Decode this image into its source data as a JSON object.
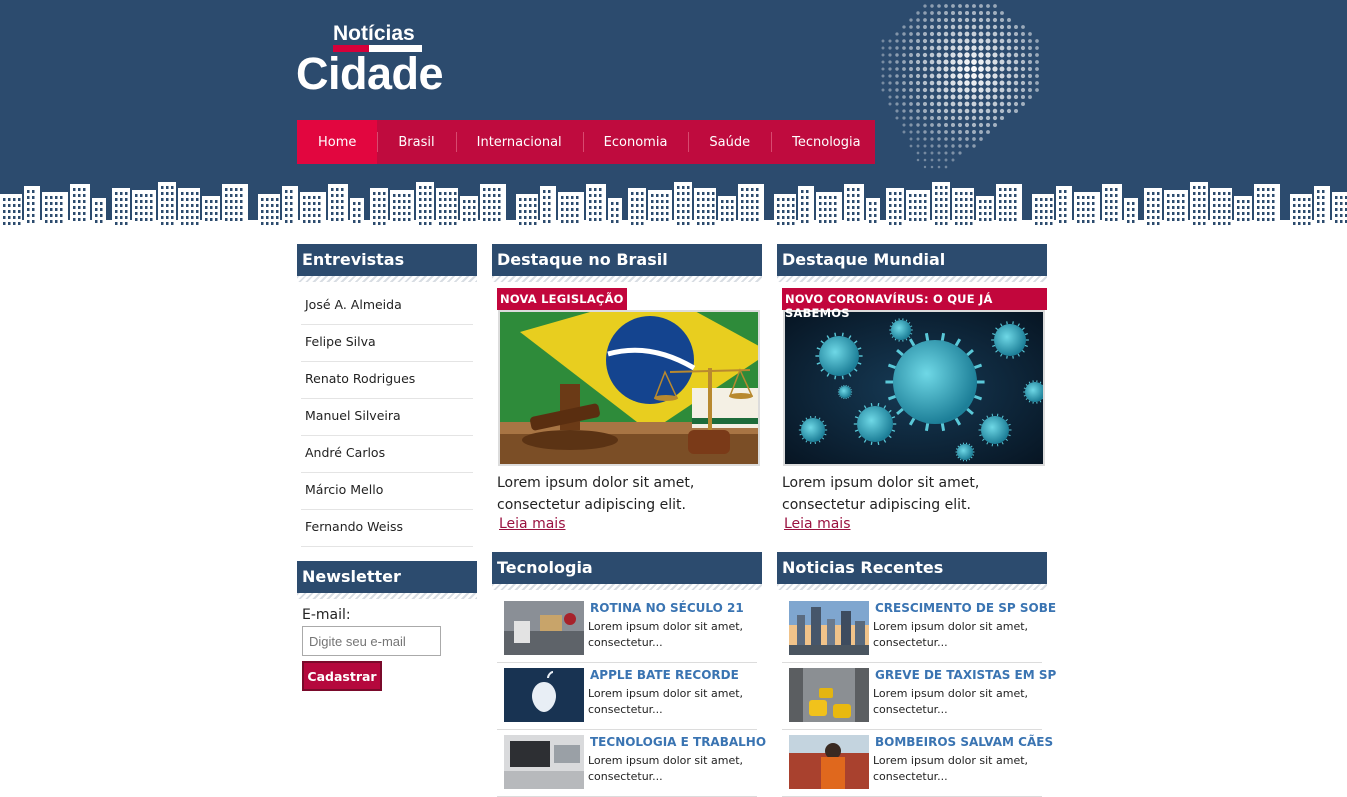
{
  "header": {
    "logo_small": "Notícias",
    "logo_big": "Cidade",
    "nav": [
      "Home",
      "Brasil",
      "Internacional",
      "Economia",
      "Saúde",
      "Tecnologia"
    ]
  },
  "entrevistas": {
    "title": "Entrevistas",
    "items": [
      "José A. Almeida",
      "Felipe Silva",
      "Renato Rodrigues",
      "Manuel Silveira",
      "André Carlos",
      "Márcio Mello",
      "Fernando Weiss"
    ]
  },
  "newsletter": {
    "title": "Newsletter",
    "email_label": "E-mail:",
    "email_placeholder": "Digite seu e-mail",
    "submit_label": "Cadastrar"
  },
  "destaque_brasil": {
    "title": "Destaque no Brasil",
    "tag": "NOVA LEGISLAÇÃO",
    "text": "Lorem ipsum dolor sit amet, consectetur adipiscing elit.",
    "more": "Leia mais"
  },
  "destaque_mundial": {
    "title": "Destaque Mundial",
    "tag": "NOVO CORONAVÍRUS: O QUE JÁ SABEMOS",
    "text": "Lorem ipsum dolor sit amet, consectetur adipiscing elit.",
    "more": "Leia mais"
  },
  "tecnologia": {
    "title": "Tecnologia",
    "items": [
      {
        "title": "ROTINA NO SÉCULO 21",
        "desc": "Lorem ipsum dolor sit amet, consectetur..."
      },
      {
        "title": "APPLE BATE RECORDE",
        "desc": "Lorem ipsum dolor sit amet, consectetur..."
      },
      {
        "title": "TECNOLOGIA E TRABALHO",
        "desc": "Lorem ipsum dolor sit amet, consectetur..."
      }
    ]
  },
  "recentes": {
    "title": "Noticias Recentes",
    "items": [
      {
        "title": "CRESCIMENTO DE SP SOBE",
        "desc": "Lorem ipsum dolor sit amet, consectetur..."
      },
      {
        "title": "GREVE DE TAXISTAS EM SP",
        "desc": "Lorem ipsum dolor sit amet, consectetur..."
      },
      {
        "title": "BOMBEIROS SALVAM CÃES",
        "desc": "Lorem ipsum dolor sit amet, consectetur..."
      }
    ]
  },
  "colors": {
    "header_bg": "#2c4b6e",
    "nav_bg": "#bf0b3e",
    "nav_active": "#e2063f",
    "link": "#3a74b2"
  }
}
